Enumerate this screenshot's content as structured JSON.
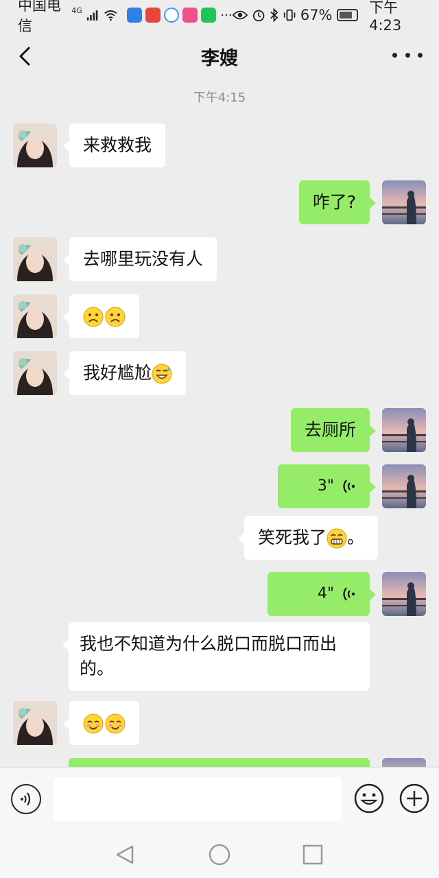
{
  "status": {
    "carrier": "中国电信",
    "network": "4G",
    "battery": "67%",
    "time": "下午4:23"
  },
  "header": {
    "title": "李嫂",
    "back_icon": "chevron-left-icon",
    "more_icon": "more-dots-icon"
  },
  "chat": {
    "timestamp": "下午4:15",
    "messages": [
      {
        "side": "in",
        "text": "来救救我"
      },
      {
        "side": "out",
        "text": "咋了?"
      },
      {
        "side": "in",
        "text": "去哪里玩没有人"
      },
      {
        "side": "in",
        "text": "",
        "emoji": [
          "frown",
          "frown"
        ]
      },
      {
        "side": "in",
        "text": "我好尴尬",
        "emoji": [
          "sweat-smile"
        ]
      },
      {
        "side": "out",
        "text": "去厕所"
      },
      {
        "side": "out",
        "voice": "3\""
      },
      {
        "side": "in-noavatar",
        "text": "笑死我了",
        "emoji": [
          "grin"
        ],
        "suffix": "。"
      },
      {
        "side": "out",
        "voice": "4\""
      },
      {
        "side": "in-noavatar",
        "text": "我也不知道为什么脱口而脱口而出的。"
      },
      {
        "side": "in",
        "text": "",
        "emoji": [
          "blush",
          "blush"
        ]
      }
    ]
  },
  "input_bar": {
    "voice_icon": "voice-mode-icon",
    "emoji_icon": "emoji-icon",
    "plus_icon": "plus-icon",
    "placeholder": ""
  },
  "colors": {
    "background": "#ededed",
    "outgoing_bubble": "#95ec69",
    "incoming_bubble": "#ffffff"
  }
}
